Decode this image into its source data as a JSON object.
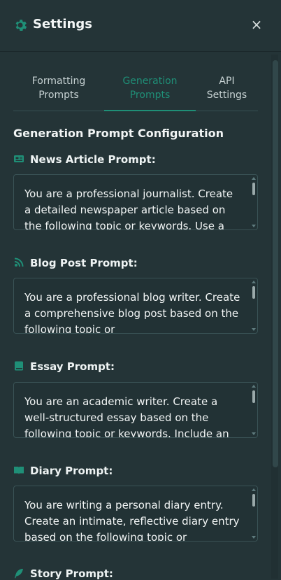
{
  "header": {
    "title": "Settings",
    "close_label": "×"
  },
  "tabs": [
    {
      "line1": "Formatting",
      "line2": "Prompts",
      "active": false
    },
    {
      "line1": "Generation",
      "line2": "Prompts",
      "active": true
    },
    {
      "line1": "API",
      "line2": "Settings",
      "active": false
    }
  ],
  "section_title": "Generation Prompt Configuration",
  "prompts": [
    {
      "label": "News Article Prompt:",
      "icon": "newspaper-icon",
      "text": "You are a professional journalist. Create a detailed newspaper article based on the following topic or keywords. Use a"
    },
    {
      "label": "Blog Post Prompt:",
      "icon": "blog-icon",
      "text": "You are a professional blog writer. Create a comprehensive blog post based on the following topic or"
    },
    {
      "label": "Essay Prompt:",
      "icon": "book-icon",
      "text": "You are an academic writer. Create a well-structured essay based on the following topic or keywords. Include an"
    },
    {
      "label": "Diary Prompt:",
      "icon": "open-book-icon",
      "text": "You are writing a personal diary entry. Create an intimate, reflective diary entry based on the following topic or"
    },
    {
      "label": "Story Prompt:",
      "icon": "feather-icon",
      "text": ""
    }
  ],
  "colors": {
    "accent": "#1f8f77",
    "background": "#243437",
    "panel_border": "#3a5356"
  }
}
